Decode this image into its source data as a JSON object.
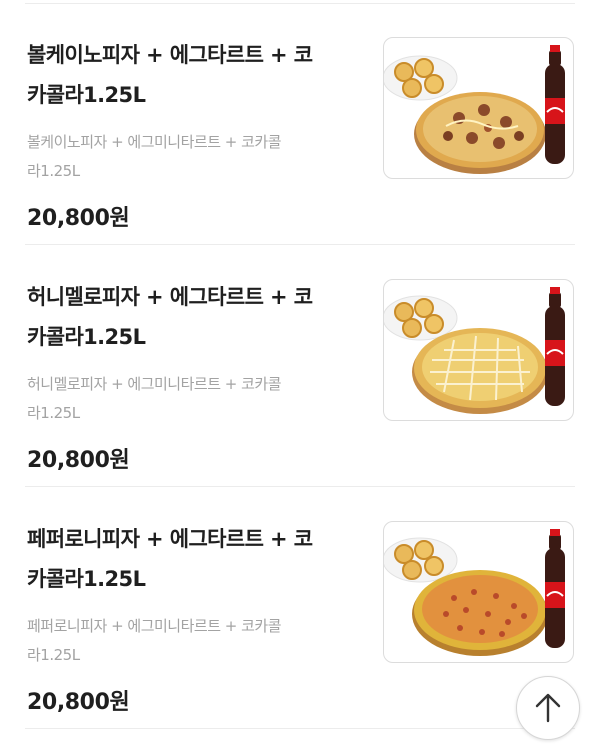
{
  "menu": {
    "items": [
      {
        "name_line1": "볼케이노피자 + 에그타르트 + 코",
        "name_line2": "카콜라1.25L",
        "desc_line1": "볼케이노피자 + 에그미니타르트 + 코카콜",
        "desc_line2": "라1.25L",
        "price": "20,800원",
        "image": "volcano-pizza-set-image"
      },
      {
        "name_line1": "허니멜로피자 + 에그타르트 + 코",
        "name_line2": "카콜라1.25L",
        "desc_line1": "허니멜로피자 + 에그미니타르트 + 코카콜",
        "desc_line2": "라1.25L",
        "price": "20,800원",
        "image": "honey-mello-pizza-set-image"
      },
      {
        "name_line1": "페퍼로니피자 + 에그타르트 + 코",
        "name_line2": "카콜라1.25L",
        "desc_line1": "페퍼로니피자 + 에그미니타르트 + 코카콜",
        "desc_line2": "라1.25L",
        "price": "20,800원",
        "image": "pepperoni-pizza-set-image"
      }
    ]
  },
  "scroll_top": {
    "icon": "arrow-up-icon"
  },
  "colors": {
    "text": "#1f1f1f",
    "desc": "#a3a3a3",
    "divider": "#ececec",
    "border": "#dcdcdc",
    "coke_red": "#d7141a"
  }
}
